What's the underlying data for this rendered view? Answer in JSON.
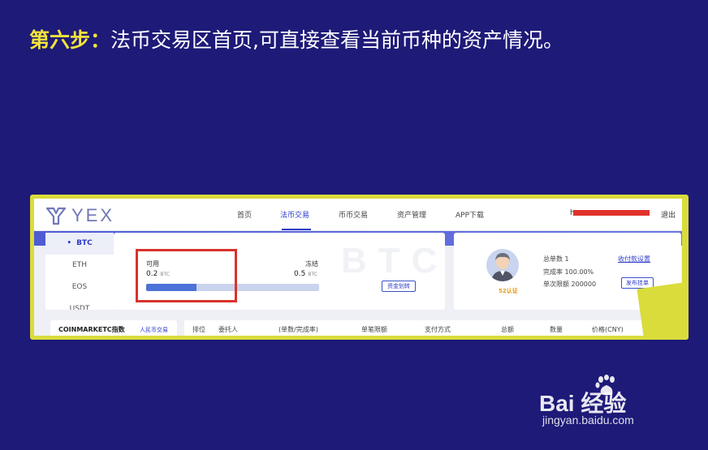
{
  "title": {
    "step": "第六步：",
    "text": "法币交易区首页,可直接查看当前币种的资产情况。"
  },
  "nav": {
    "logo": "YEX",
    "items": [
      "首页",
      "法币交易",
      "币币交易",
      "资产管理",
      "APP下载"
    ],
    "active_item": "法币交易",
    "user": "h",
    "logout": "退出"
  },
  "coins": [
    "BTC",
    "ETH",
    "EOS",
    "USDT"
  ],
  "active_coin": "BTC",
  "balance": {
    "watermark": "BTC",
    "available_label": "可用",
    "available_value": "0.2",
    "frozen_label": "冻结",
    "frozen_value": "0.5",
    "unit": "BTC",
    "available_fraction": 0.29,
    "transfer_button": "资金划转"
  },
  "profile": {
    "badge": "52认证",
    "orders": "总单数 1",
    "completion": "完成率 100.00%",
    "limit": "单次限额 200000",
    "settings_link": "收付款设置",
    "post_button": "发布挂单"
  },
  "index_panel": {
    "title": "COINMARKETC指数",
    "link": "人民币交易"
  },
  "table": {
    "headers": [
      "排位",
      "委托人",
      "(单数/完成率)",
      "单笔限额",
      "支付方式",
      "总额",
      "数量",
      "价格(CNY)"
    ]
  },
  "watermark": {
    "logo": "Bai  经验",
    "url": "jingyan.baidu.com"
  },
  "colors": {
    "background": "#1e1a78",
    "accent": "#2c3bc8",
    "highlight": "#d8322c",
    "frame": "#d9dc3a",
    "step_label": "#f2e33a"
  }
}
